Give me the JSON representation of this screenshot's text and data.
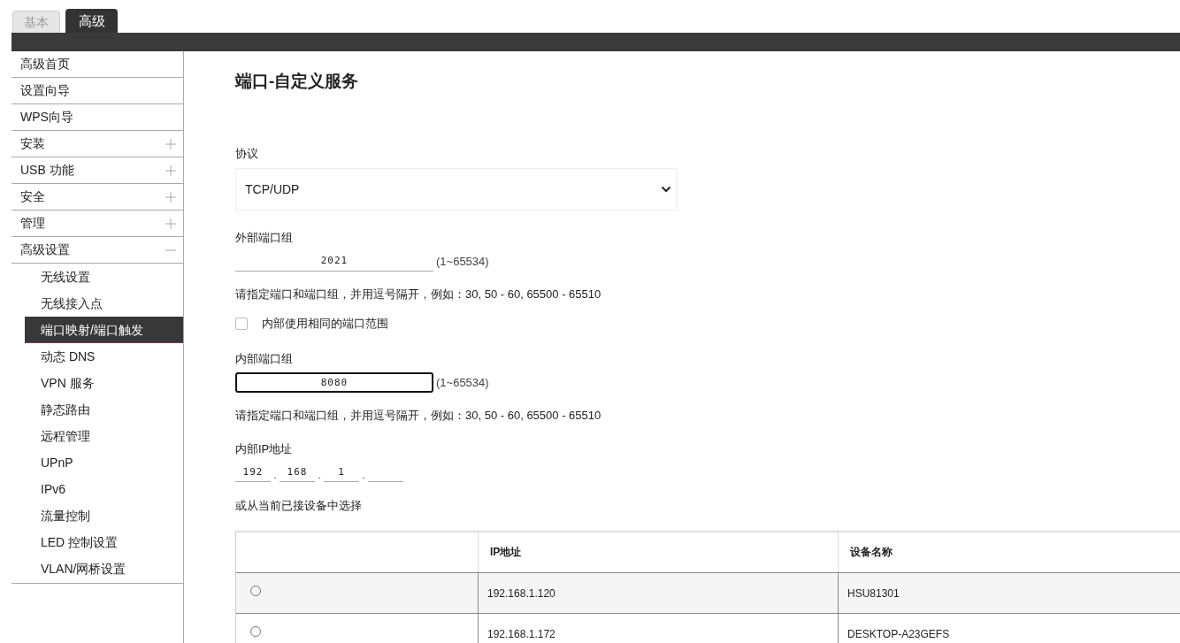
{
  "tabs": [
    {
      "label": "基本",
      "selected": false
    },
    {
      "label": "高级",
      "selected": true
    }
  ],
  "sidebar": {
    "items": [
      {
        "kind": "link",
        "label": "高级首页",
        "selected": false
      },
      {
        "kind": "link",
        "label": "设置向导",
        "selected": false
      },
      {
        "kind": "link",
        "label": "WPS向导",
        "selected": false
      },
      {
        "kind": "group",
        "label": "安装",
        "selected": false,
        "expanded": false
      },
      {
        "kind": "group",
        "label": "USB 功能",
        "selected": false,
        "expanded": false
      },
      {
        "kind": "group",
        "label": "安全",
        "selected": false,
        "expanded": false
      },
      {
        "kind": "group",
        "label": "管理",
        "selected": false,
        "expanded": false
      },
      {
        "kind": "group",
        "label": "高级设置",
        "selected": false,
        "expanded": true,
        "children": [
          {
            "label": "无线设置",
            "selected": false
          },
          {
            "label": "无线接入点",
            "selected": false
          },
          {
            "label": "端口映射/端口触发",
            "selected": true
          },
          {
            "label": "动态 DNS",
            "selected": false
          },
          {
            "label": "VPN 服务",
            "selected": false
          },
          {
            "label": "静态路由",
            "selected": false
          },
          {
            "label": "远程管理",
            "selected": false
          },
          {
            "label": "UPnP",
            "selected": false
          },
          {
            "label": "IPv6",
            "selected": false
          },
          {
            "label": "流量控制",
            "selected": false
          },
          {
            "label": "LED 控制设置",
            "selected": false
          },
          {
            "label": "VLAN/网桥设置",
            "selected": false
          }
        ]
      }
    ]
  },
  "page": {
    "title": "端口-自定义服务",
    "protocol": {
      "label": "协议",
      "value": "TCP/UDP"
    },
    "external_ports": {
      "label": "外部端口组",
      "value": "2021",
      "range": "(1~65534)",
      "focused": false
    },
    "external_hint": "请指定端口和端口组，并用逗号隔开，例如：30, 50 - 60, 65500 - 65510",
    "same_range": {
      "label": "内部使用相同的端口范围",
      "checked": false
    },
    "internal_ports": {
      "label": "内部端口组",
      "value": "8080",
      "range": "(1~65534)",
      "focused": true
    },
    "internal_hint": "请指定端口和端口组，并用逗号隔开，例如：30, 50 - 60, 65500 - 65510",
    "internal_ip": {
      "label": "内部IP地址",
      "octets": [
        "192",
        "168",
        "1"
      ],
      "separator": "."
    },
    "device_prompt": "或从当前已接设备中选择",
    "devices": {
      "columns": [
        "IP地址",
        "设备名称"
      ],
      "rows": [
        {
          "selected": false,
          "ip": "192.168.1.120",
          "name": "HSU81301"
        },
        {
          "selected": false,
          "ip": "192.168.1.172",
          "name": "DESKTOP-A23GEFS"
        }
      ]
    }
  }
}
